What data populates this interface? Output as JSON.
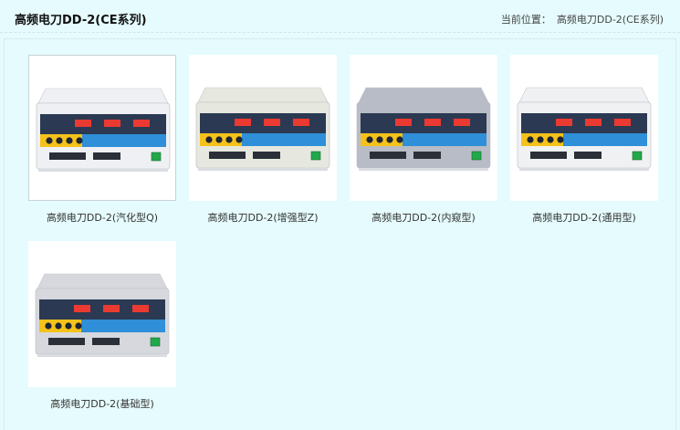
{
  "header": {
    "title": "高频电刀DD-2(CE系列)",
    "breadcrumb_label": "当前位置：",
    "breadcrumb_current": "高频电刀DD-2(CE系列)"
  },
  "products": [
    {
      "name": "高频电刀DD-2(汽化型Q)",
      "body_color": "#eef0f3",
      "selected": true
    },
    {
      "name": "高频电刀DD-2(增强型Z)",
      "body_color": "#e6e8df",
      "selected": false
    },
    {
      "name": "高频电刀DD-2(内窥型)",
      "body_color": "#b8bcc6",
      "selected": false
    },
    {
      "name": "高频电刀DD-2(通用型)",
      "body_color": "#f0f1f3",
      "selected": false
    },
    {
      "name": "高频电刀DD-2(基础型)",
      "body_color": "#d6d8de",
      "selected": false
    }
  ],
  "colors": {
    "page_background": "#e5fbfd",
    "panel_dark": "#2b3a52",
    "panel_yellow": "#f4c21a",
    "panel_blue": "#2f8fd8",
    "display_red": "#ff3b2f",
    "power_green": "#22a84a"
  }
}
